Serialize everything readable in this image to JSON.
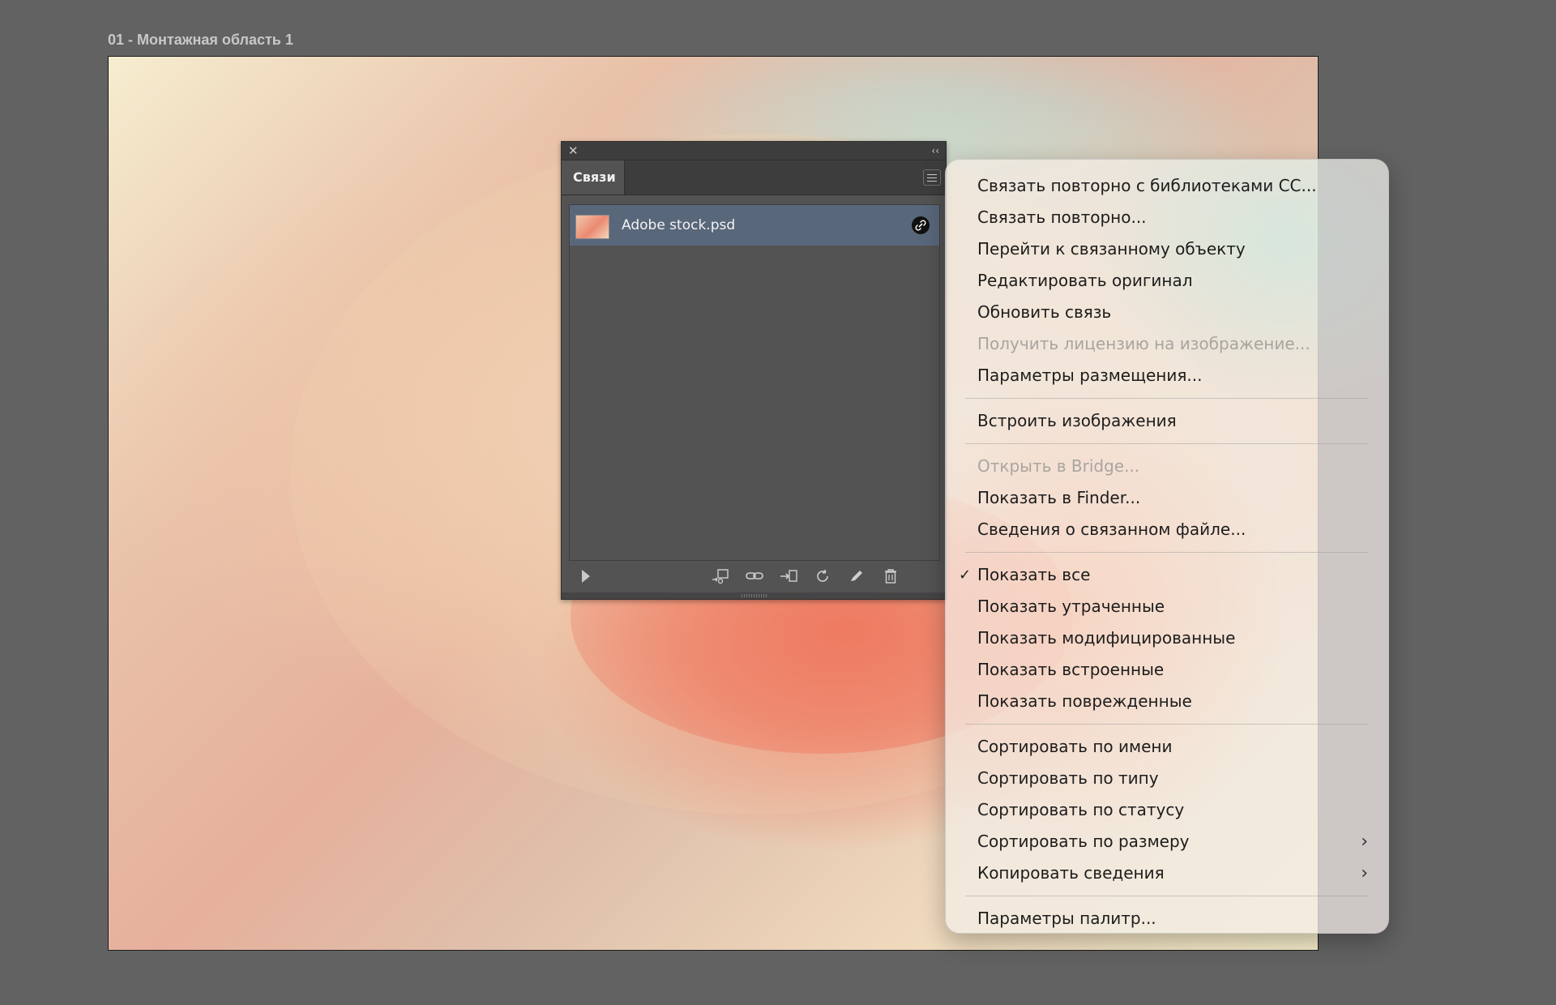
{
  "artboard": {
    "label": "01 - Монтажная область 1"
  },
  "panel": {
    "close_glyph": "✕",
    "collapse_glyph": "‹‹",
    "tab_label": "Связи",
    "items": [
      {
        "name": "Adobe stock.psd",
        "status_icon": "link-icon"
      }
    ],
    "footer_icons": [
      "show-info-triangle",
      "relink-from-cc-icon",
      "relink-icon",
      "go-to-link-icon",
      "update-link-icon",
      "edit-original-icon",
      "delete-icon"
    ]
  },
  "context_menu": {
    "groups": [
      [
        {
          "label": "Связать повторно с библиотеками CC...",
          "disabled": false
        },
        {
          "label": "Связать повторно...",
          "disabled": false
        },
        {
          "label": "Перейти к связанному объекту",
          "disabled": false
        },
        {
          "label": "Редактировать оригинал",
          "disabled": false
        },
        {
          "label": "Обновить связь",
          "disabled": false
        },
        {
          "label": "Получить лицензию на изображение...",
          "disabled": true
        },
        {
          "label": "Параметры размещения...",
          "disabled": false
        }
      ],
      [
        {
          "label": "Встроить изображения",
          "disabled": false
        }
      ],
      [
        {
          "label": "Открыть в Bridge...",
          "disabled": true
        },
        {
          "label": "Показать в Finder...",
          "disabled": false
        },
        {
          "label": "Сведения о связанном файле...",
          "disabled": false
        }
      ],
      [
        {
          "label": "Показать все",
          "checked": true
        },
        {
          "label": "Показать утраченные"
        },
        {
          "label": "Показать модифицированные"
        },
        {
          "label": "Показать встроенные"
        },
        {
          "label": "Показать поврежденные"
        }
      ],
      [
        {
          "label": "Сортировать по имени"
        },
        {
          "label": "Сортировать по типу"
        },
        {
          "label": "Сортировать по статусу"
        },
        {
          "label": "Сортировать по размеру",
          "submenu": true
        },
        {
          "label": "Копировать сведения",
          "submenu": true
        }
      ],
      [
        {
          "label": "Параметры палитр..."
        }
      ]
    ]
  }
}
